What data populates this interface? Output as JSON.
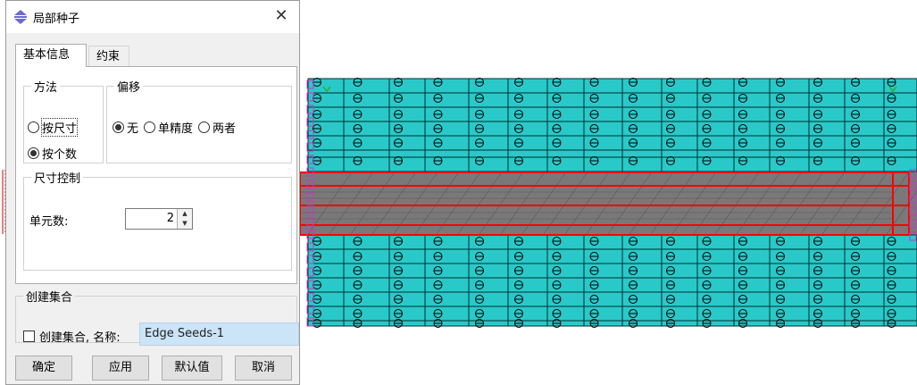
{
  "dialog": {
    "title": "局部种子",
    "close_symbol": "✕",
    "tabs": [
      {
        "label": "基本信息",
        "active": true
      },
      {
        "label": "约束",
        "active": false
      }
    ],
    "method": {
      "legend": "方法",
      "options": [
        {
          "label": "按尺寸",
          "selected": false
        },
        {
          "label": "按个数",
          "selected": true
        }
      ]
    },
    "bias": {
      "legend": "偏移",
      "options": [
        {
          "label": "无",
          "selected": true
        },
        {
          "label": "单精度",
          "selected": false
        },
        {
          "label": "两者",
          "selected": false
        }
      ]
    },
    "sizing": {
      "legend": "尺寸控制",
      "element_count_label": "单元数:",
      "element_count_value": "2"
    },
    "create_set": {
      "legend": "创建集合",
      "checkbox_label": "创建集合, 名称:",
      "checked": false,
      "name_value": "Edge Seeds-1"
    },
    "buttons": {
      "ok": "确定",
      "apply": "应用",
      "defaults": "默认值",
      "cancel": "取消"
    }
  },
  "viewport": {
    "colors": {
      "mesh_fill": "#2ac9c9",
      "mesh_line": "#003030",
      "selected_band": "#7a7878",
      "selection_outline": "#ff0000",
      "constraint_marker": "#cc33cc",
      "seed_marker": "#000000",
      "background": "#ffffff"
    }
  }
}
